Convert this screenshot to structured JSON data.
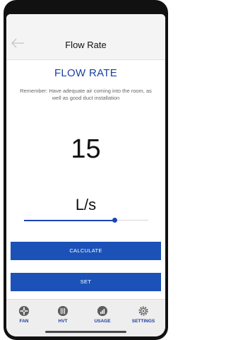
{
  "header": {
    "title": "Flow Rate",
    "back_icon": "arrow-left-icon"
  },
  "main": {
    "heading": "FLOW RATE",
    "reminder": "Remember: Have adequate air coming into the room, as well as good duct installation",
    "value": "15",
    "unit": "L/s",
    "slider_level": 0.73
  },
  "buttons": {
    "calculate": "CALCULATE",
    "set": "SET"
  },
  "nav": {
    "items": [
      {
        "label": "FAN",
        "icon": "fan-icon"
      },
      {
        "label": "HVT",
        "icon": "hvt-icon"
      },
      {
        "label": "USAGE",
        "icon": "usage-chart-icon"
      },
      {
        "label": "SETTINGS",
        "icon": "gear-icon"
      }
    ]
  },
  "colors": {
    "accent": "#1c52b8",
    "title_blue": "#1a3fa0",
    "nav_label": "#1c3f9e"
  }
}
